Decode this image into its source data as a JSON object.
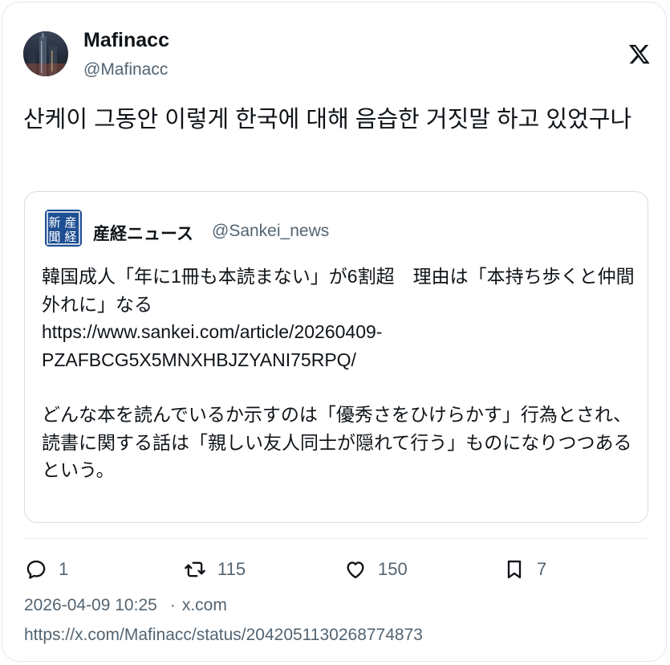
{
  "author": {
    "display_name": "Mafinacc",
    "handle": "@Mafinacc"
  },
  "tweet": {
    "text": "산케이 그동안 이렇게 한국에 대해 음습한 거짓말 하고 있었구나"
  },
  "quoted": {
    "display_name": "産経ニュース",
    "handle": "@Sankei_news",
    "avatar_glyphs": [
      "新",
      "産",
      "聞",
      "経"
    ],
    "paragraph1": "韓国成人「年に1冊も本読まない」が6割超　理由は「本持ち歩くと仲間外れに」なる\nhttps://www.sankei.com/article/20260409-PZAFBCG5X5MNXHBJZYANI75RPQ/",
    "paragraph2": "どんな本を読んでいるか示すのは「優秀さをひけらかす」行為とされ、読書に関する話は「親しい友人同士が隠れて行う」ものになりつつあるという。"
  },
  "actions": {
    "replies": "1",
    "reposts": "115",
    "likes": "150",
    "bookmarks": "7"
  },
  "meta": {
    "timestamp": "2026-04-09 10:25",
    "separator": "·",
    "source": "x.com"
  },
  "permalink": "https://x.com/Mafinacc/status/2042051130268774873",
  "colors": {
    "text_primary": "#0f1419",
    "text_secondary": "#536471",
    "border": "#e1e8ed",
    "sankei_blue": "#1f4f93"
  }
}
